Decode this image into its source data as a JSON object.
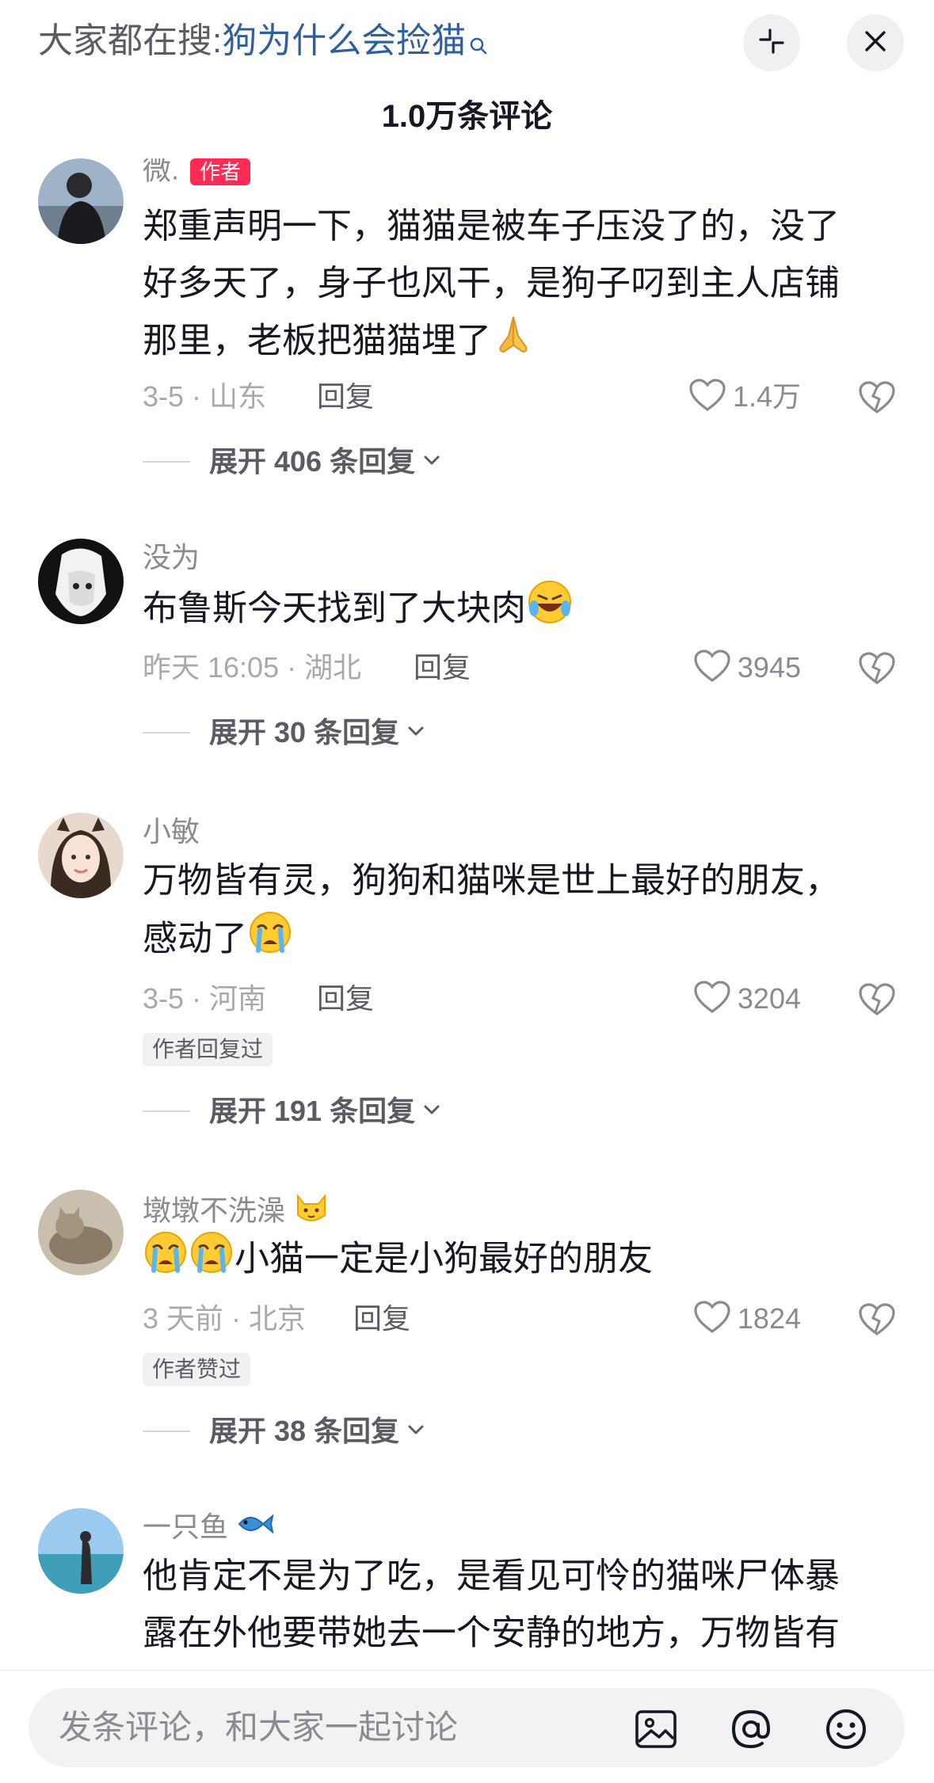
{
  "search": {
    "prefix": "大家都在搜:",
    "query": "狗为什么会捡猫"
  },
  "header": {
    "title": "1.0万条评论"
  },
  "comments": [
    {
      "username": "微.",
      "author_tag": "作者",
      "text": "郑重声明一下，猫猫是被车子压没了的，没了好多天了，身子也风干，是狗子叼到主人店铺那里，老板把猫猫埋了",
      "emoji": "folded-hands",
      "date_location": "3-5 · 山东",
      "reply": "回复",
      "likes": "1.4万",
      "expand": "展开 406 条回复"
    },
    {
      "username": "没为",
      "text": "布鲁斯今天找到了大块肉",
      "emoji": "rofl",
      "date_location": "昨天 16:05 · 湖北",
      "reply": "回复",
      "likes": "3945",
      "expand": "展开 30 条回复"
    },
    {
      "username": "小敏",
      "text": "万物皆有灵，狗狗和猫咪是世上最好的朋友，感动了",
      "emoji": "crying",
      "date_location": "3-5 · 河南",
      "reply": "回复",
      "likes": "3204",
      "badge": "作者回复过",
      "expand": "展开 191 条回复"
    },
    {
      "username": "墩墩不洗澡",
      "text": "小猫一定是小狗最好的朋友",
      "emoji": "crying",
      "date_location": "3 天前 · 北京",
      "reply": "回复",
      "likes": "1824",
      "badge": "作者赞过",
      "expand": "展开 38 条回复"
    },
    {
      "username": "一只鱼",
      "text": "他肯定不是为了吃，是看见可怜的猫咪尸体暴露在外他要带她去一个安静的地方，万物皆有"
    }
  ],
  "composer": {
    "placeholder": "发条评论，和大家一起讨论"
  },
  "colors": {
    "link": "#2f5f9e",
    "author_tag": "#fe2c55",
    "muted": "#a8a9ae"
  }
}
